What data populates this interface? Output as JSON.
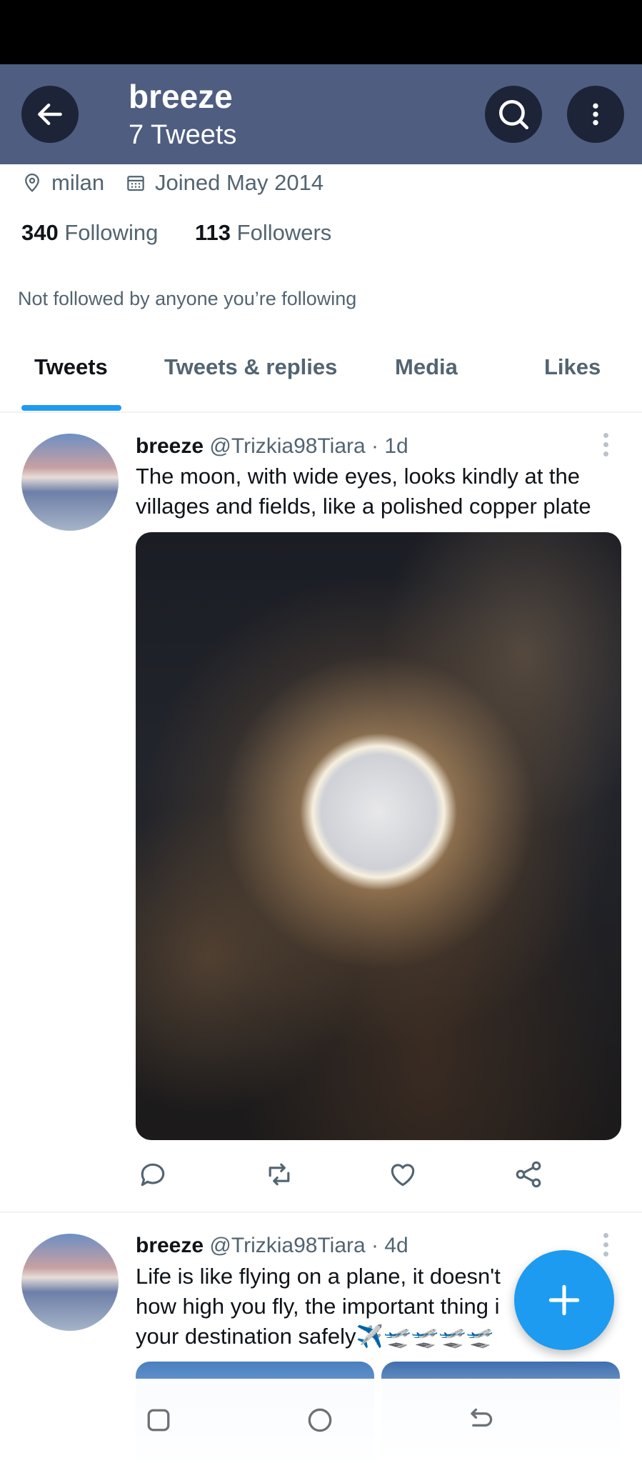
{
  "header": {
    "name": "breeze",
    "tweet_count": "7 Tweets"
  },
  "profile": {
    "location": "milan",
    "joined": "Joined May 2014",
    "following_count": "340",
    "following_label": "Following",
    "followers_count": "113",
    "followers_label": "Followers",
    "not_followed_note": "Not followed by anyone you’re following"
  },
  "tabs": [
    {
      "label": "Tweets",
      "active": true
    },
    {
      "label": "Tweets & replies",
      "active": false
    },
    {
      "label": "Media",
      "active": false
    },
    {
      "label": "Likes",
      "active": false
    }
  ],
  "tweets": [
    {
      "name": "breeze",
      "handle": "@Trizkia98Tiara",
      "time": "· 1d",
      "text_line1": "The moon, with wide eyes, looks kindly at the",
      "text_line2": "villages and fields, like a polished copper plate"
    },
    {
      "name": "breeze",
      "handle": "@Trizkia98Tiara",
      "time": "· 4d",
      "text_line1": "Life is like flying on a plane, it doesn't",
      "text_line2": "how high you fly, the important thing i",
      "text_line3": "your destination safely✈️🛫🛫🛫🛫"
    }
  ],
  "colors": {
    "header_bg": "#4e5d80",
    "accent": "#1d9bf0",
    "muted_text": "#536471"
  },
  "icons": [
    "back-arrow-icon",
    "search-icon",
    "more-vertical-icon",
    "location-pin-icon",
    "calendar-icon",
    "reply-icon",
    "retweet-icon",
    "like-icon",
    "share-icon",
    "compose-plus-icon",
    "recents-icon",
    "home-icon",
    "back-icon"
  ]
}
